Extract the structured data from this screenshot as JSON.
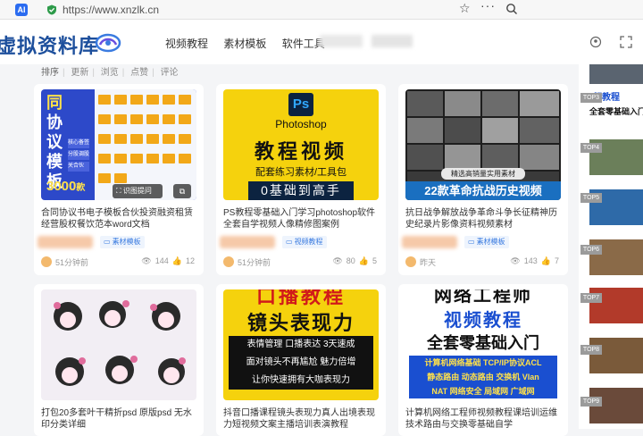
{
  "browser": {
    "url": "https://www.xnzlk.cn",
    "tab_icon_label": "AI",
    "more_label": "···"
  },
  "site": {
    "logo_text": "虚拟资料库",
    "nav": [
      "视频教程",
      "素材模板",
      "软件工具"
    ]
  },
  "sort": {
    "label": "排序",
    "options": [
      "更新",
      "浏览",
      "点赞",
      "评论"
    ]
  },
  "cards": [
    {
      "title": "合同协议书电子模板合伙投资融资租赁经营股权餐饮范本word文档",
      "tag": "素材模板",
      "time": "51分钟前",
      "views": "144",
      "likes": "12",
      "thumb_text": [
        "同",
        "协",
        "议",
        "模",
        "板"
      ],
      "thumb_count": "3000",
      "thumb_unit": "款",
      "overlay_label": "识图提问",
      "thumb_side": [
        "核心备签",
        "分股调股",
        "关合伙"
      ]
    },
    {
      "title": "PS教程零基础入门学习photoshop软件全套自学视频人像精修图案例",
      "tag": "视频教程",
      "time": "51分钟前",
      "views": "80",
      "likes": "5",
      "thumb_logo": "Ps",
      "thumb_brand": "Photoshop",
      "thumb_headline": "教程视频",
      "thumb_sub": "配套练习素材/工具包",
      "thumb_footer": "0基础到高手"
    },
    {
      "title": "抗日战争解放战争革命斗争长征精神历史纪录片影像资料视频素材",
      "tag": "素材模板",
      "time": "昨天",
      "views": "143",
      "likes": "7",
      "thumb_band": "精选高销量实用素材",
      "thumb_footer": "22款革命抗战历史视频"
    },
    {
      "title": "打包20多套叶干精折psd 原版psd 无水印分类详细",
      "tag": "",
      "time": "",
      "views": "",
      "likes": ""
    },
    {
      "title": "抖音口播课程镜头表现力真人出境表现力短视频文案主播培训表演教程",
      "tag": "",
      "time": "",
      "views": "",
      "likes": "",
      "thumb_top": "口播教程",
      "thumb_headline": "镜头表现力",
      "thumb_lines": [
        "表情管理  口播表达  3天速成",
        "面对镜头不再尴尬  魅力倍增",
        "让你快速拥有大咖表现力"
      ]
    },
    {
      "title": "计算机网络工程师视频教程课培训运维技术路由与交换零基础自学",
      "tag": "",
      "time": "",
      "views": "",
      "likes": "",
      "thumb_top": "网络工程师",
      "thumb_headline": "视频教程",
      "thumb_sub": "全套零基础入门",
      "thumb_lines": [
        "计算机网络基础   TCP/IP协议ACL",
        "静态路由  动态路由  交换机 Vlan",
        "NAT  网络安全  局域网  广域网"
      ]
    }
  ],
  "side_ranks": [
    "TOP3",
    "TOP4",
    "TOP5",
    "TOP6",
    "TOP7",
    "TOP8",
    "TOP9"
  ],
  "side_snippets": [
    "频教程",
    "全套零基础入门"
  ],
  "colors": {
    "accent_blue": "#3a7be0",
    "logo_blue": "#1d4f9c",
    "ps_yellow": "#f5d20d",
    "rank_gray": "#9b9b9b"
  }
}
